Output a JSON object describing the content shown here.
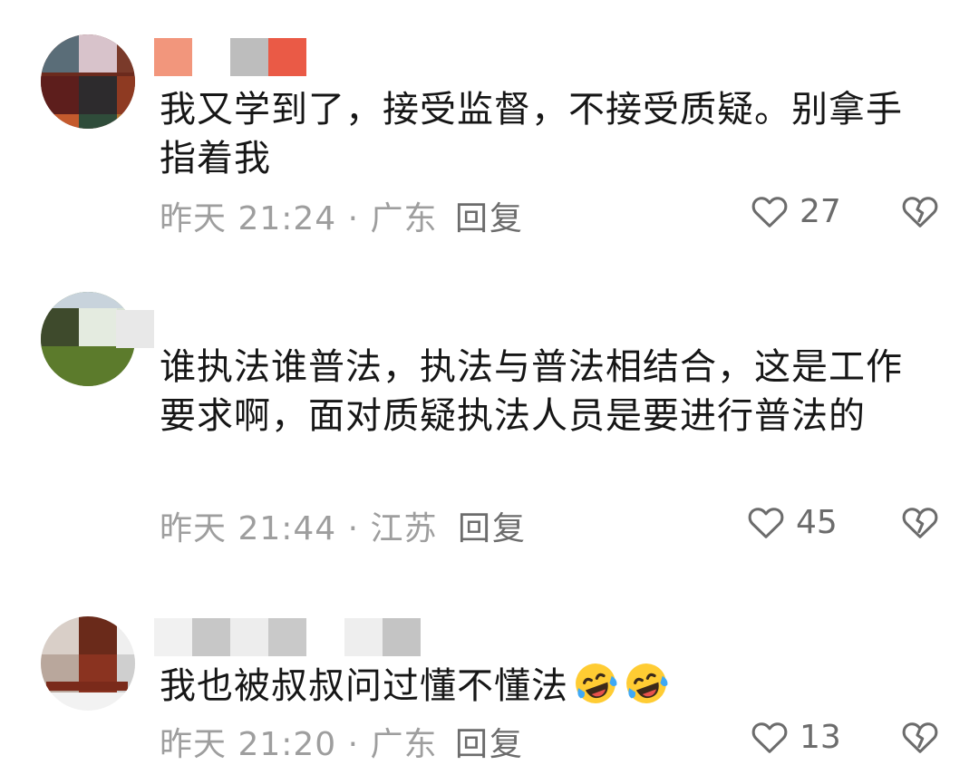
{
  "comments": [
    {
      "text": "我又学到了，接受监督，不接受质疑。别拿手指着我",
      "meta": "昨天 21:24 · 广东",
      "reply_label": "回复",
      "likes": "27"
    },
    {
      "text": "谁执法谁普法，执法与普法相结合，这是工作要求啊，面对质疑执法人员是要进行普法的",
      "meta": "昨天 21:44 · 江苏",
      "reply_label": "回复",
      "likes": "45"
    },
    {
      "text": "我也被叔叔问过懂不懂法",
      "emoji": [
        "rolling-on-floor-laughing",
        "rolling-on-floor-laughing"
      ],
      "meta": "昨天 21:20 · 广东",
      "reply_label": "回复",
      "likes": "13"
    }
  ],
  "colors": {
    "text": "#161616",
    "meta": "#9e9e9e",
    "action": "#6c6c6c",
    "background": "#ffffff"
  },
  "icons": {
    "like": "heart-outline-icon",
    "dislike": "broken-heart-icon"
  }
}
